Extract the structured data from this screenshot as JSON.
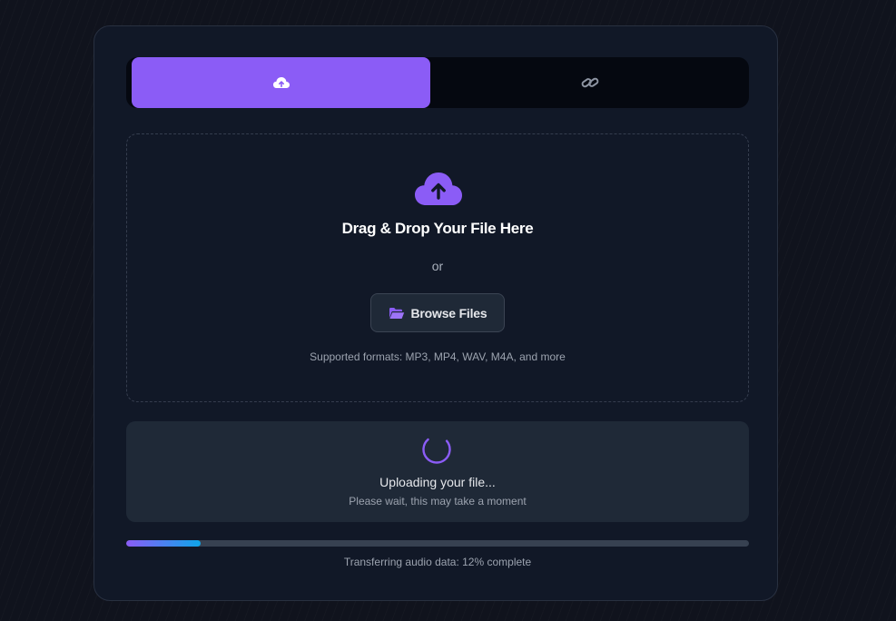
{
  "tabs": [
    {
      "icon": "cloud-upload-icon",
      "active": true
    },
    {
      "icon": "link-icon",
      "active": false
    }
  ],
  "dropzone": {
    "icon": "cloud-upload-icon",
    "title": "Drag & Drop Your File Here",
    "or": "or",
    "browse_icon": "folder-open-icon",
    "browse_label": "Browse Files",
    "formats": "Supported formats: MP3, MP4, WAV, M4A, and more"
  },
  "status": {
    "icon": "spinner-icon",
    "title": "Uploading your file...",
    "subtitle": "Please wait, this may take a moment"
  },
  "progress": {
    "percent": 12,
    "text": "Transferring audio data: 12% complete"
  },
  "colors": {
    "accent": "#8b5cf6",
    "progress_end": "#0ea5e9",
    "card_bg": "#111827",
    "panel_bg": "#1f2937"
  }
}
